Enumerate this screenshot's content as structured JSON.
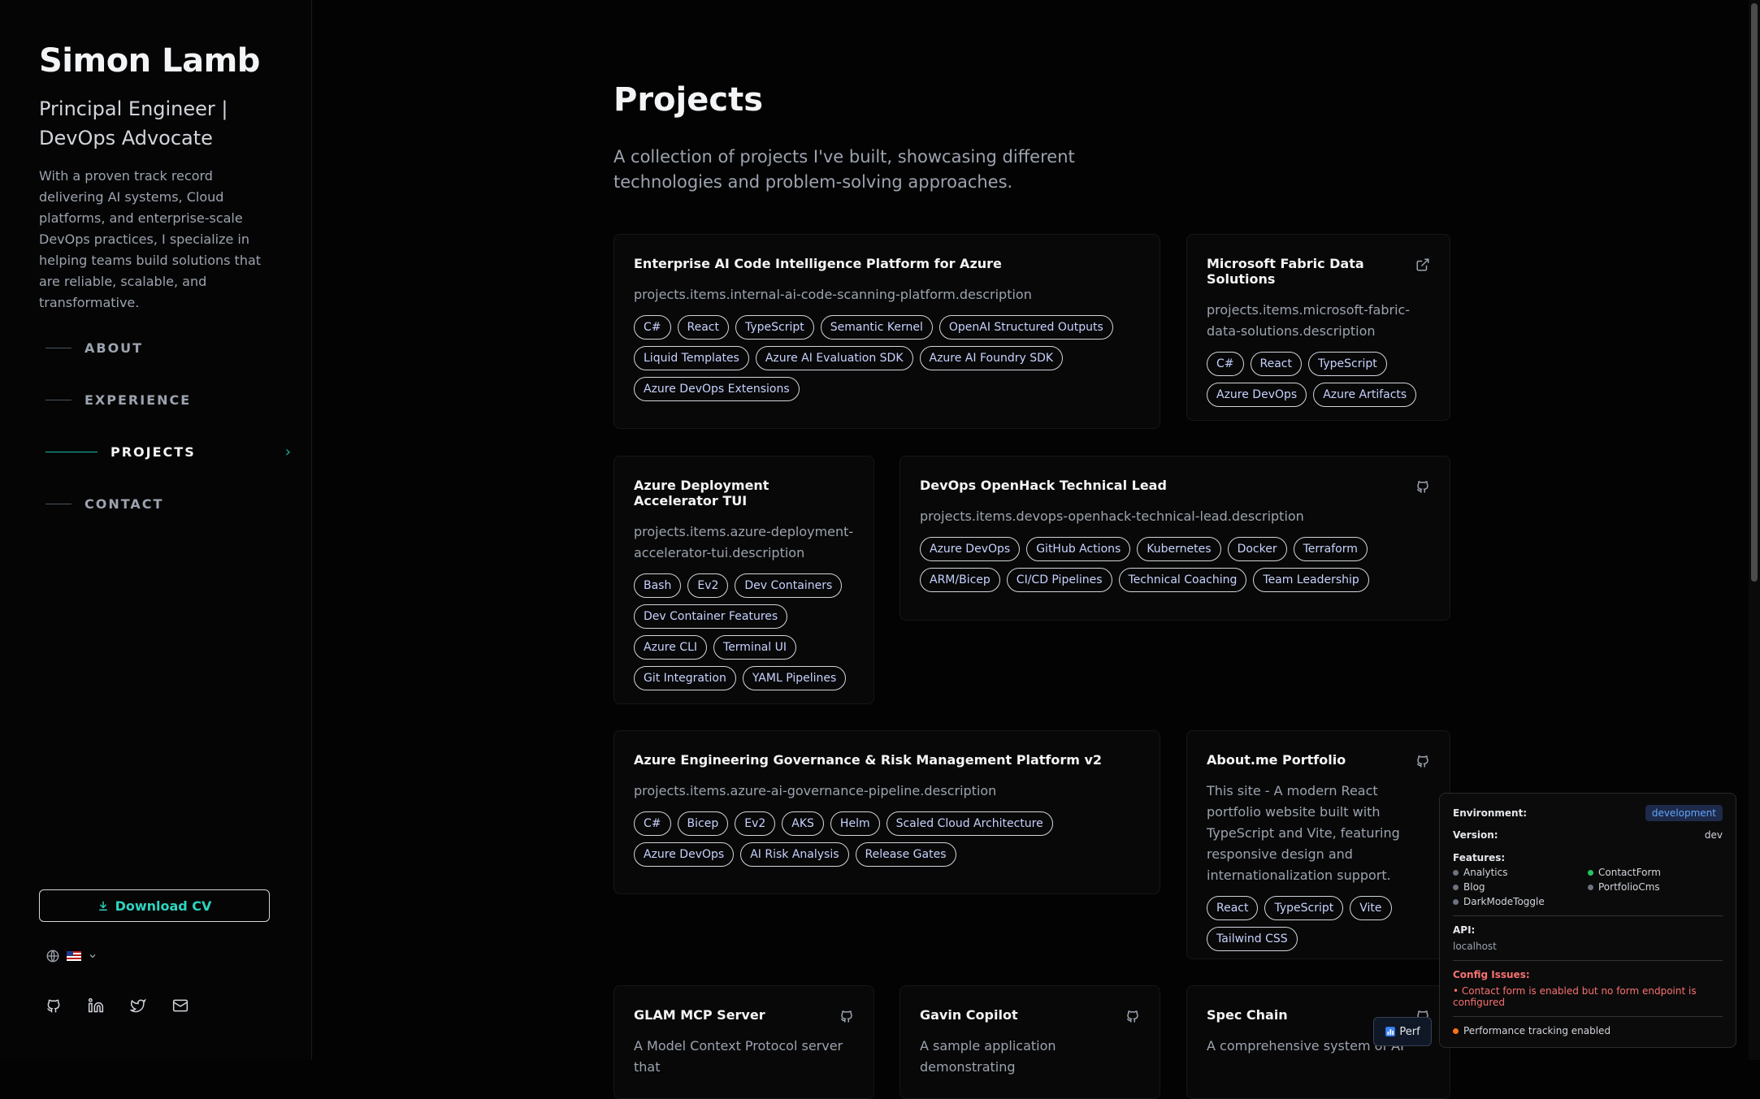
{
  "profile": {
    "name": "Simon Lamb",
    "role": "Principal Engineer | DevOps Advocate",
    "bio": "With a proven track record delivering AI systems, Cloud platforms, and enterprise-scale DevOps practices, I specialize in helping teams build solutions that are reliable, scalable, and transformative."
  },
  "nav": {
    "items": [
      {
        "label": "ABOUT",
        "active": false
      },
      {
        "label": "EXPERIENCE",
        "active": false
      },
      {
        "label": "PROJECTS",
        "active": true
      },
      {
        "label": "CONTACT",
        "active": false
      }
    ],
    "active_chevron": "›"
  },
  "sidebar_footer": {
    "download_label": "Download CV",
    "language_flag": "us-flag",
    "socials": [
      "github-icon",
      "linkedin-icon",
      "twitter-icon",
      "mail-icon"
    ]
  },
  "page": {
    "title": "Projects",
    "intro": "A collection of projects I've built, showcasing different technologies and problem-solving approaches."
  },
  "projects": [
    {
      "title": "Enterprise AI Code Intelligence Platform for Azure",
      "description": "projects.items.internal-ai-code-scanning-platform.description",
      "icon": "none",
      "tags": [
        "C#",
        "React",
        "TypeScript",
        "Semantic Kernel",
        "OpenAI Structured Outputs",
        "Liquid Templates",
        "Azure AI Evaluation SDK",
        "Azure AI Foundry SDK",
        "Azure DevOps Extensions"
      ]
    },
    {
      "title": "Microsoft Fabric Data Solutions",
      "description": "projects.items.microsoft-fabric-data-solutions.description",
      "icon": "external-link-icon",
      "tags": [
        "C#",
        "React",
        "TypeScript",
        "Azure DevOps",
        "Azure Artifacts"
      ]
    },
    {
      "title": "Azure Deployment Accelerator TUI",
      "description": "projects.items.azure-deployment-accelerator-tui.description",
      "icon": "none",
      "tags": [
        "Bash",
        "Ev2",
        "Dev Containers",
        "Dev Container Features",
        "Azure CLI",
        "Terminal UI",
        "Git Integration",
        "YAML Pipelines"
      ]
    },
    {
      "title": "DevOps OpenHack Technical Lead",
      "description": "projects.items.devops-openhack-technical-lead.description",
      "icon": "github-icon",
      "tags": [
        "Azure DevOps",
        "GitHub Actions",
        "Kubernetes",
        "Docker",
        "Terraform",
        "ARM/Bicep",
        "CI/CD Pipelines",
        "Technical Coaching",
        "Team Leadership"
      ]
    },
    {
      "title": "Azure Engineering Governance & Risk Management Platform v2",
      "description": "projects.items.azure-ai-governance-pipeline.description",
      "icon": "none",
      "tags": [
        "C#",
        "Bicep",
        "Ev2",
        "AKS",
        "Helm",
        "Scaled Cloud Architecture",
        "Azure DevOps",
        "AI Risk Analysis",
        "Release Gates"
      ]
    },
    {
      "title": "About.me Portfolio",
      "description": "This site - A modern React portfolio website built with TypeScript and Vite, featuring responsive design and internationalization support.",
      "icon": "github-icon",
      "tags": [
        "React",
        "TypeScript",
        "Vite",
        "Tailwind CSS"
      ]
    },
    {
      "title": "GLAM MCP Server",
      "description": "A Model Context Protocol server that",
      "icon": "github-icon",
      "tags": []
    },
    {
      "title": "Gavin Copilot",
      "description": "A sample application demonstrating",
      "icon": "github-icon",
      "tags": []
    },
    {
      "title": "Spec Chain",
      "description": "A comprehensive system of AI",
      "icon": "github-icon",
      "tags": []
    }
  ],
  "debug_panel": {
    "environment_label": "Environment:",
    "environment_value": "development",
    "version_label": "Version:",
    "version_value": "dev",
    "features_label": "Features:",
    "features": [
      {
        "name": "Analytics",
        "enabled": false
      },
      {
        "name": "ContactForm",
        "enabled": true
      },
      {
        "name": "Blog",
        "enabled": false
      },
      {
        "name": "PortfolioCms",
        "enabled": false
      },
      {
        "name": "DarkModeToggle",
        "enabled": false
      }
    ],
    "api_label": "API:",
    "api_value": "localhost",
    "issues_label": "Config Issues:",
    "issue": "• Contact form is enabled but no form endpoint is configured",
    "perf_note": "Performance tracking enabled",
    "perf_button_label": "Perf",
    "colors": {
      "accent": "#14b8a6",
      "error": "#f87171",
      "env_badge": "#60a5fa"
    }
  }
}
